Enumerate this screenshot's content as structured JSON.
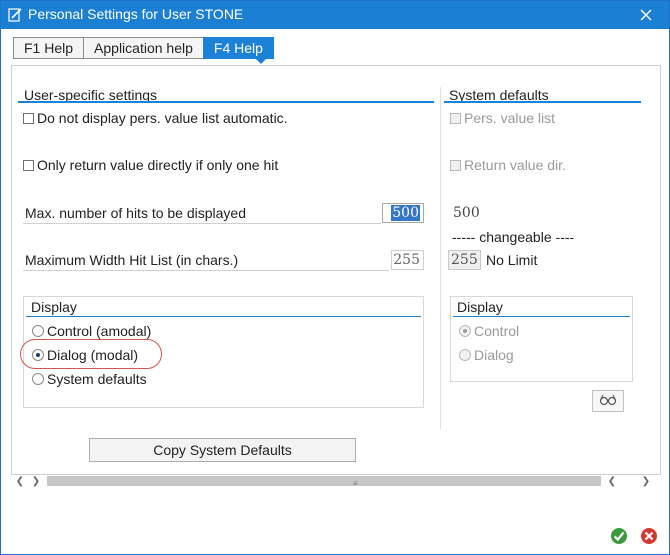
{
  "window": {
    "title": "Personal Settings for User STONE",
    "title_icon": "pencil-document-icon",
    "close_icon": "close-icon"
  },
  "tabs": [
    {
      "label": "F1 Help",
      "active": false
    },
    {
      "label": "Application help",
      "active": false
    },
    {
      "label": "F4 Help",
      "active": true
    }
  ],
  "user_settings": {
    "title": "User-specific settings",
    "no_display_label": "Do not display pers. value list automatic.",
    "only_return_label": "Only return value directly if only one hit",
    "max_hits_label": "Max. number of hits to be displayed",
    "max_hits_value": "500",
    "max_width_label": "Maximum Width Hit List (in chars.)",
    "max_width_value": "255",
    "display": {
      "title": "Display",
      "options": [
        "Control (amodal)",
        "Dialog (modal)",
        "System defaults"
      ],
      "selected": "Dialog (modal)"
    }
  },
  "system_defaults": {
    "title": "System defaults",
    "pers_value_list_label": "Pers. value list",
    "return_value_label": "Return value dir.",
    "max_hits_value": "500",
    "changeable_label": "----- changeable ----",
    "width_value": "255",
    "no_limit_label": "No Limit",
    "display": {
      "title": "Display",
      "options": [
        "Control",
        "Dialog"
      ],
      "selected": "Control"
    },
    "glasses_icon": "glasses-icon"
  },
  "copy_button_label": "Copy System Defaults",
  "footer": {
    "ok_icon": "checkmark-icon",
    "cancel_icon": "cancel-icon",
    "ok_color": "#3a9a3a",
    "cancel_color": "#d63a2f"
  },
  "colors": {
    "titlebar": "#1b7fd4",
    "tab_active": "#1b82d8",
    "highlight": "#d9534f"
  }
}
